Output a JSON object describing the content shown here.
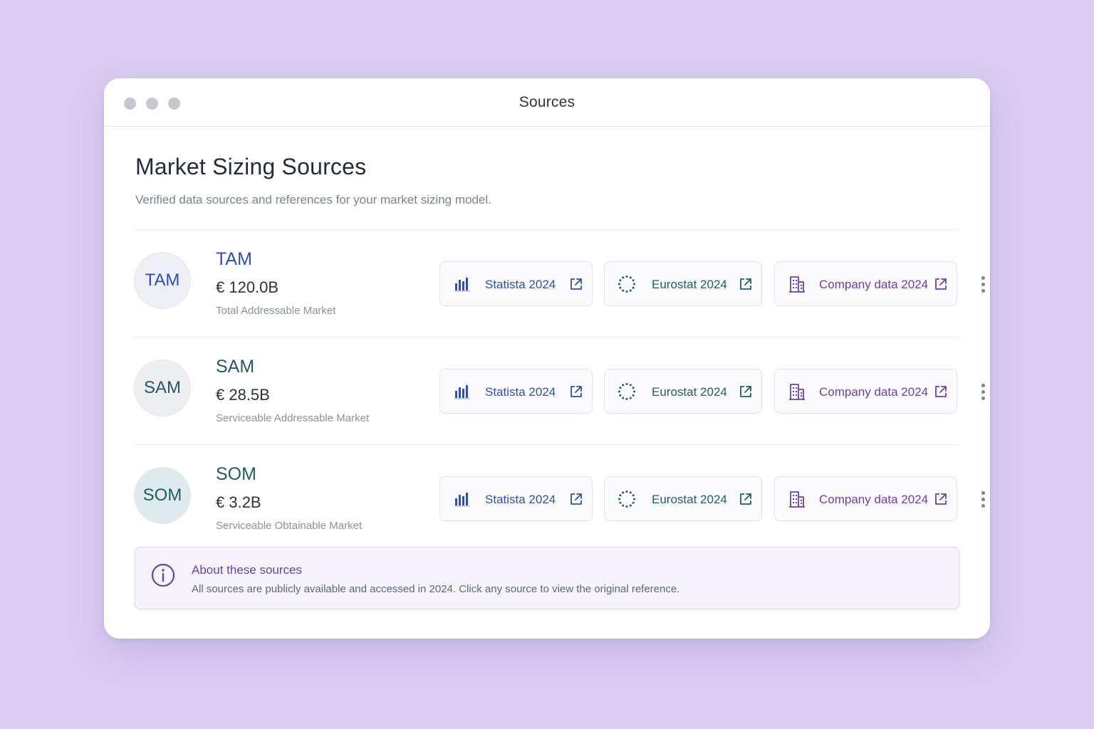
{
  "window": {
    "title": "Sources"
  },
  "header": {
    "title": "Market Sizing Sources",
    "subtitle": "Verified data sources and references for your market sizing model."
  },
  "rows": [
    {
      "abbr": "TAM",
      "name": "TAM",
      "value": "€ 120.0B",
      "description": "Total Addressable Market",
      "color": "#2f4fb0",
      "badge_bg": "#eef0f5",
      "sources": [
        "Statista 2024",
        "Eurostat 2024",
        "Company data 2024"
      ]
    },
    {
      "abbr": "SAM",
      "name": "SAM",
      "value": "€ 28.5B",
      "description": "Serviceable Addressable Market",
      "color": "#255860",
      "badge_bg": "#eceef2",
      "sources": [
        "Statista 2024",
        "Eurostat 2024",
        "Company data 2024"
      ]
    },
    {
      "abbr": "SOM",
      "name": "SOM",
      "value": "€ 3.2B",
      "description": "Serviceable Obtainable Market",
      "color": "#1f5e62",
      "badge_bg": "#dfeaed",
      "sources": [
        "Statista 2024",
        "Eurostat 2024",
        "Company data 2024"
      ]
    }
  ],
  "icons": {
    "statista": "bar-chart-icon",
    "eurostat": "eu-stars-icon",
    "company": "building-icon",
    "external": "external-link-icon",
    "more": "more-vertical-icon",
    "info": "info-icon"
  },
  "colors": {
    "statista": "#2f4fa8",
    "eurostat": "#1f5e66",
    "company": "#6a3fb0"
  },
  "notice": {
    "title": "About these sources",
    "text": "All sources are publicly available and accessed in 2024. Click any source to view the original reference."
  }
}
